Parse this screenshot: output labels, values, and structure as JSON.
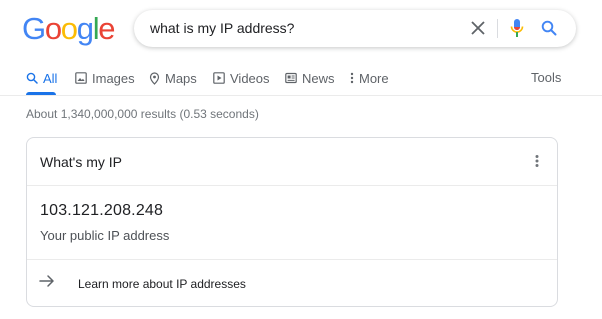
{
  "logo": {
    "letters": [
      "G",
      "o",
      "o",
      "g",
      "l",
      "e"
    ]
  },
  "search": {
    "query": "what is my IP address?"
  },
  "tabs": [
    {
      "label": "All",
      "icon": "search-icon",
      "active": true
    },
    {
      "label": "Images",
      "icon": "image-icon"
    },
    {
      "label": "Maps",
      "icon": "map-pin-icon"
    },
    {
      "label": "Videos",
      "icon": "play-icon"
    },
    {
      "label": "News",
      "icon": "news-icon"
    },
    {
      "label": "More",
      "icon": "more-vert-icon"
    }
  ],
  "tools_label": "Tools",
  "stats": "About 1,340,000,000 results (0.53 seconds)",
  "card": {
    "title": "What's my IP",
    "ip": "103.121.208.248",
    "caption": "Your public IP address",
    "learn_more": "Learn more about IP addresses"
  },
  "colors": {
    "accent": "#1a73e8",
    "google_blue": "#4285f4",
    "google_red": "#ea4335",
    "google_yellow": "#fbbc05",
    "google_green": "#34a853"
  }
}
